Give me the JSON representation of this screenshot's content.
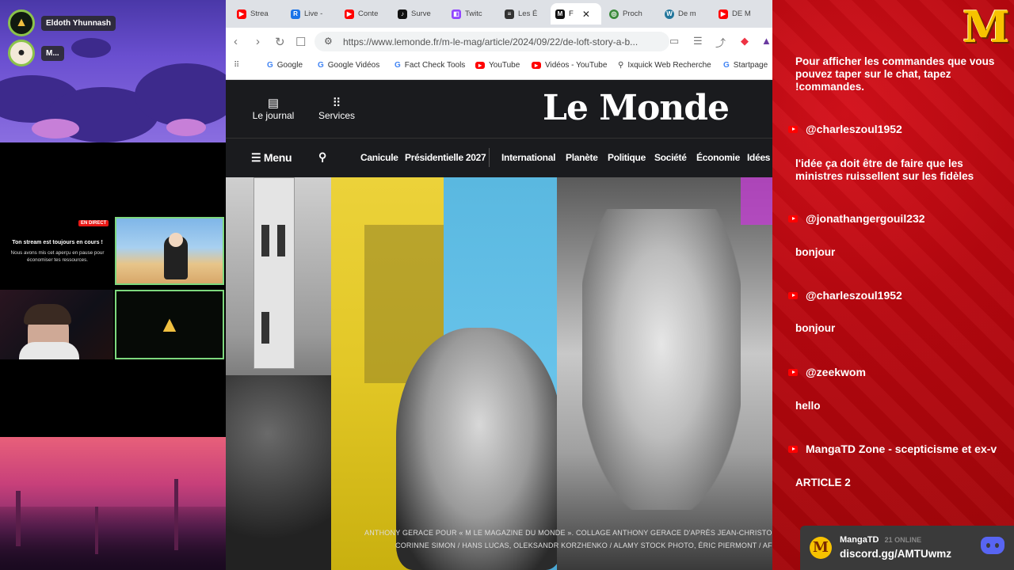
{
  "stream": {
    "users": [
      {
        "name": "Eldoth Yhunnash"
      },
      {
        "name": "M..."
      }
    ],
    "live_badge": "EN DIRECT",
    "paused_title": "Ton stream est toujours en cours !",
    "paused_sub_1": "Nous avons mis cet aperçu en pause pour",
    "paused_sub_2": "économiser tes ressources."
  },
  "browser": {
    "tabs": [
      {
        "label": "Strea",
        "icon": "youtube-icon",
        "color": "#ff0000"
      },
      {
        "label": "Live -",
        "icon": "r-icon",
        "color": "#1a73e8"
      },
      {
        "label": "Conte",
        "icon": "youtube-icon",
        "color": "#ff0000"
      },
      {
        "label": "Surve",
        "icon": "tiktok-icon",
        "color": "#111111"
      },
      {
        "label": "Twitc",
        "icon": "twitch-icon",
        "color": "#9146ff"
      },
      {
        "label": "Les É",
        "icon": "news-icon",
        "color": "#333333"
      },
      {
        "label": "F",
        "icon": "lemonde-icon",
        "color": "#111111"
      },
      {
        "label": "Proch",
        "icon": "globe-icon",
        "color": "#3b8a3b"
      },
      {
        "label": "De m",
        "icon": "wordpress-icon",
        "color": "#21759b"
      },
      {
        "label": "DE M",
        "icon": "youtube-icon",
        "color": "#ff0000"
      }
    ],
    "url": "https://www.lemonde.fr/m-le-mag/article/2024/09/22/de-loft-story-a-b...",
    "bookmarks": [
      {
        "label": "Google",
        "icon": "google-icon"
      },
      {
        "label": "Google Vidéos",
        "icon": "google-icon"
      },
      {
        "label": "Fact Check Tools",
        "icon": "google-icon"
      },
      {
        "label": "YouTube",
        "icon": "youtube-icon"
      },
      {
        "label": "Vidéos - YouTube",
        "icon": "youtube-icon"
      },
      {
        "label": "Ixquick Web Recherche",
        "icon": "search-icon"
      },
      {
        "label": "Startpage",
        "icon": "google-icon"
      }
    ]
  },
  "lemonde": {
    "logo": "Le Monde",
    "journal_label": "Le journal",
    "services_label": "Services",
    "menu_label": "Menu",
    "nav": [
      "Canicule",
      "Présidentielle 2027",
      "International",
      "Planète",
      "Politique",
      "Société",
      "Économie",
      "Idées"
    ],
    "credit_line_1": "ANTHONY GERACE POUR « M LE MAGAZINE DU MONDE ». COLLAGE ANTHONY GERACE D'APRÈS JEAN-CHRISTOPHE",
    "credit_line_2": "CORINNE SIMON / HANS LUCAS, OLEKSANDR KORZHENKO / ALAMY STOCK PHOTO, ÉRIC PIERMONT / AFP"
  },
  "chat": {
    "messages": [
      {
        "type": "text",
        "text": "Pour afficher les commandes que vous pouvez taper sur le chat, tapez !commandes."
      },
      {
        "type": "user",
        "text": "@charleszoul1952"
      },
      {
        "type": "text",
        "text": "l'idée ça doit être de faire que les ministres ruissellent sur les fidèles"
      },
      {
        "type": "user",
        "text": "@jonathangergouil232"
      },
      {
        "type": "text",
        "text": "bonjour"
      },
      {
        "type": "user",
        "text": "@charleszoul1952"
      },
      {
        "type": "text",
        "text": "bonjour"
      },
      {
        "type": "user",
        "text": "@zeekwom"
      },
      {
        "type": "text",
        "text": "hello"
      },
      {
        "type": "user",
        "text": "MangaTD Zone - scepticisme et ex-v"
      },
      {
        "type": "text",
        "text": "ARTICLE 2"
      }
    ],
    "logo_letter": "M",
    "discord_name": "MangaTD",
    "discord_online": "21 ONLINE",
    "discord_link": "discord.gg/AMTUwmz"
  },
  "colors": {
    "chat_bg": "#b8070f",
    "lemonde_bg": "#1a1b1e",
    "accent_gold": "#f7c200"
  }
}
